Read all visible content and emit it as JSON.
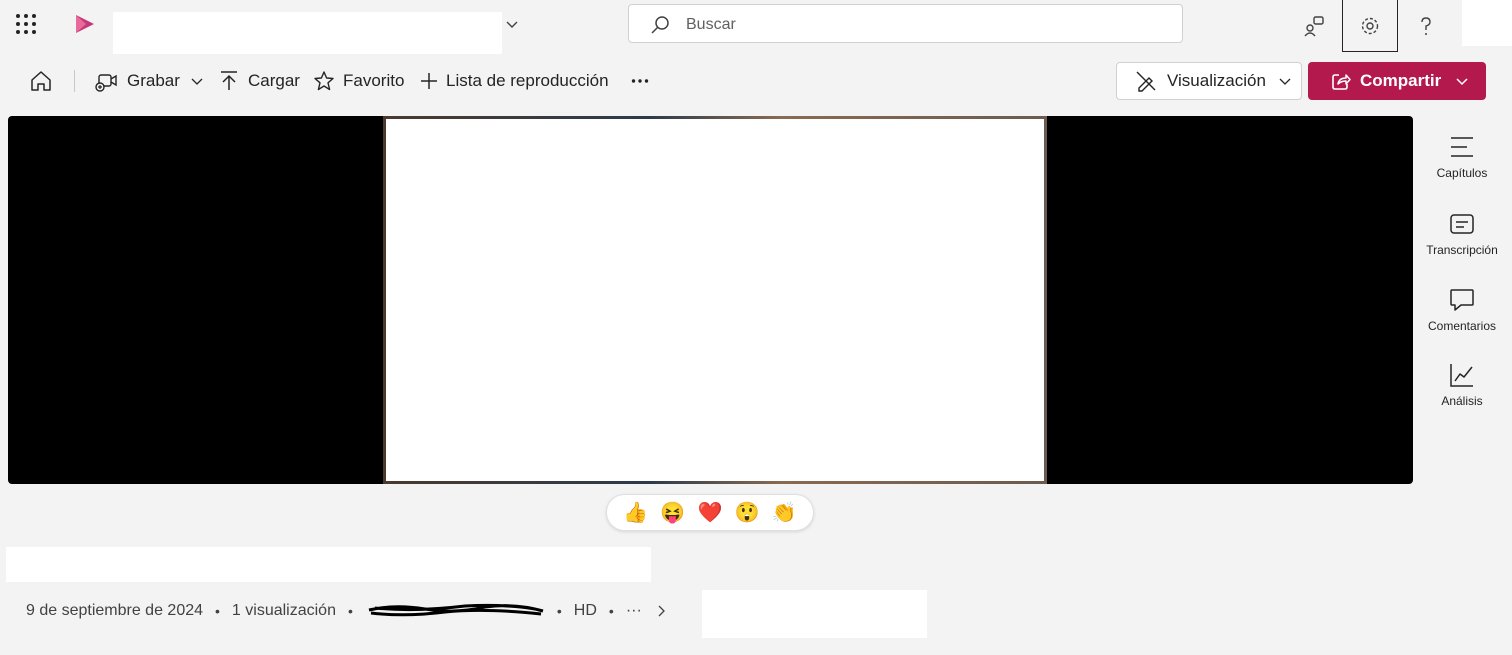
{
  "header": {
    "search_placeholder": "Buscar"
  },
  "toolbar": {
    "record_label": "Grabar",
    "upload_label": "Cargar",
    "favorite_label": "Favorito",
    "playlist_label": "Lista de reproducción",
    "view_label": "Visualización",
    "share_label": "Compartir"
  },
  "rail": {
    "chapters": "Capítulos",
    "transcript": "Transcripción",
    "comments": "Comentarios",
    "analytics": "Análisis"
  },
  "reactions": [
    "👍",
    "😝",
    "❤️",
    "😲",
    "👏"
  ],
  "meta": {
    "date": "9 de septiembre de 2024",
    "views": "1 visualización",
    "quality": "HD",
    "more": "···"
  },
  "colors": {
    "accent": "#b3194c",
    "background": "#f3f3f3"
  }
}
